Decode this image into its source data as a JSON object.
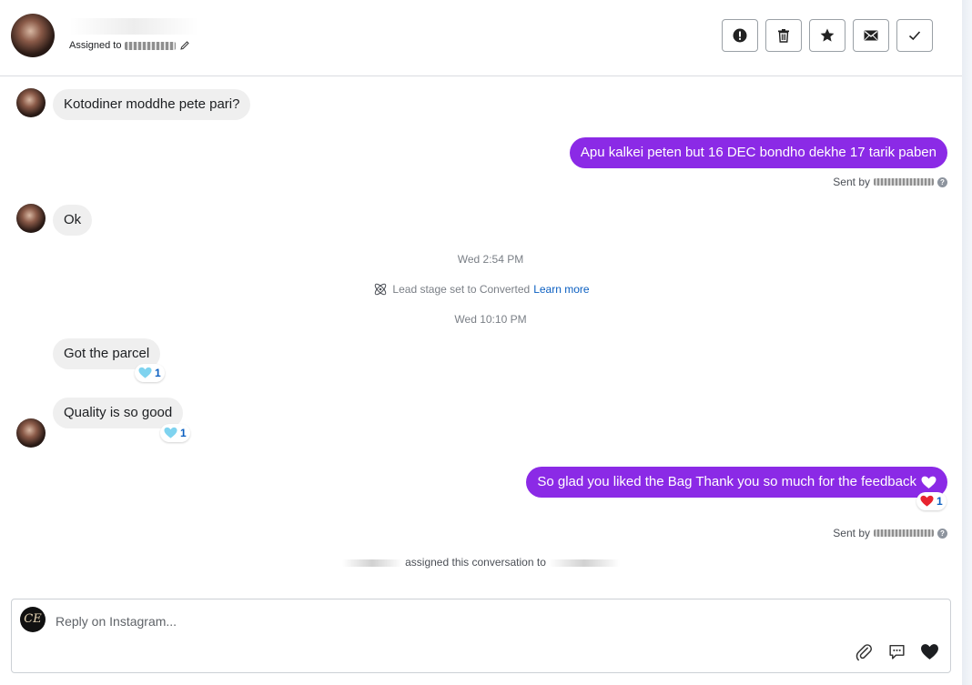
{
  "header": {
    "assigned_prefix": "Assigned to",
    "actions": [
      {
        "name": "spam-button",
        "icon": "exclamation-icon"
      },
      {
        "name": "delete-button",
        "icon": "trash-icon"
      },
      {
        "name": "star-button",
        "icon": "star-icon"
      },
      {
        "name": "mark-unread-button",
        "icon": "envelope-icon"
      },
      {
        "name": "done-button",
        "icon": "checkmark-icon"
      }
    ]
  },
  "messages": [
    {
      "id": "m1",
      "direction": "in",
      "text": "Kotodiner moddhe pete pari?"
    },
    {
      "id": "m2",
      "direction": "out",
      "text": "Apu kalkei peten but 16 DEC bondho dekhe 17 tarik paben",
      "sent_by_prefix": "Sent by"
    },
    {
      "id": "m3",
      "direction": "in",
      "text": "Ok"
    },
    {
      "id": "m4",
      "direction": "in",
      "text": "Got the parcel",
      "reaction": {
        "emoji": "blue-heart",
        "count": "1"
      }
    },
    {
      "id": "m5",
      "direction": "in",
      "text": "Quality is so good",
      "reaction": {
        "emoji": "blue-heart",
        "count": "1"
      }
    },
    {
      "id": "m6",
      "direction": "out",
      "text": "So glad you liked the Bag Thank you so much for the feedback",
      "reaction": {
        "emoji": "red-heart",
        "count": "1"
      },
      "sent_by_prefix": "Sent by"
    }
  ],
  "timestamps": {
    "t1": "Wed 2:54 PM",
    "t2": "Wed 10:10 PM"
  },
  "system_event": {
    "text": "Lead stage set to Converted",
    "link": "Learn more"
  },
  "assign_event": {
    "text": "assigned this conversation to"
  },
  "composer": {
    "brand_initials": "CE",
    "placeholder": "Reply on Instagram...",
    "icons": [
      "paperclip-icon",
      "saved-replies-icon",
      "heart-icon"
    ]
  },
  "colors": {
    "outgoing_bubble": "#8b2ae6",
    "incoming_bubble": "#efefef",
    "link": "#0b5fc1"
  }
}
